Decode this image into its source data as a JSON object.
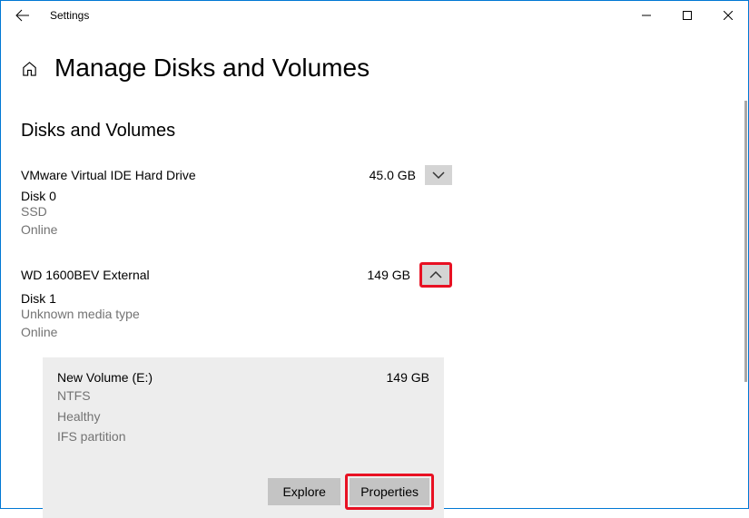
{
  "window": {
    "title": "Settings"
  },
  "page": {
    "title": "Manage Disks and Volumes",
    "section": "Disks and Volumes"
  },
  "disks": [
    {
      "name": "VMware Virtual IDE Hard Drive",
      "size": "45.0 GB",
      "id": "Disk 0",
      "media": "SSD",
      "status": "Online"
    },
    {
      "name": "WD 1600BEV External",
      "size": "149 GB",
      "id": "Disk 1",
      "media": "Unknown media type",
      "status": "Online"
    }
  ],
  "volume": {
    "name": "New Volume (E:)",
    "size": "149 GB",
    "fs": "NTFS",
    "health": "Healthy",
    "partition": "IFS partition"
  },
  "buttons": {
    "explore": "Explore",
    "properties": "Properties"
  }
}
